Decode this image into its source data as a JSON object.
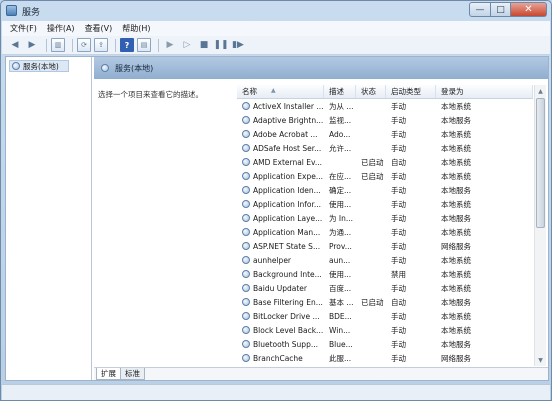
{
  "window": {
    "title": "服务"
  },
  "menu": [
    "文件(F)",
    "操作(A)",
    "查看(V)",
    "帮助(H)"
  ],
  "tree": {
    "root_label": "服务(本地)"
  },
  "panel": {
    "header": "服务(本地)",
    "description_hint": "选择一个项目来查看它的描述。"
  },
  "table": {
    "columns": [
      "名称",
      "描述",
      "状态",
      "启动类型",
      "登录为"
    ],
    "rows": [
      [
        "ActiveX Installer ...",
        "为从 ...",
        "",
        "手动",
        "本地系统"
      ],
      [
        "Adaptive Brightn...",
        "监视...",
        "",
        "手动",
        "本地服务"
      ],
      [
        "Adobe Acrobat ...",
        "Ado...",
        "",
        "手动",
        "本地系统"
      ],
      [
        "ADSafe Host Ser...",
        "允许...",
        "",
        "手动",
        "本地系统"
      ],
      [
        "AMD External Ev...",
        "",
        "已启动",
        "自动",
        "本地系统"
      ],
      [
        "Application Expe...",
        "在应...",
        "已启动",
        "手动",
        "本地系统"
      ],
      [
        "Application Iden...",
        "确定...",
        "",
        "手动",
        "本地服务"
      ],
      [
        "Application Infor...",
        "使用...",
        "",
        "手动",
        "本地系统"
      ],
      [
        "Application Laye...",
        "为 In...",
        "",
        "手动",
        "本地服务"
      ],
      [
        "Application Man...",
        "为通...",
        "",
        "手动",
        "本地系统"
      ],
      [
        "ASP.NET State S...",
        "Prov...",
        "",
        "手动",
        "网络服务"
      ],
      [
        "aunhelper",
        "aun...",
        "",
        "手动",
        "本地系统"
      ],
      [
        "Background Inte...",
        "使用...",
        "",
        "禁用",
        "本地系统"
      ],
      [
        "Baidu Updater",
        "百度...",
        "",
        "手动",
        "本地系统"
      ],
      [
        "Base Filtering En...",
        "基本 ...",
        "已启动",
        "自动",
        "本地服务"
      ],
      [
        "BitLocker Drive ...",
        "BDE...",
        "",
        "手动",
        "本地系统"
      ],
      [
        "Block Level Back...",
        "Win...",
        "",
        "手动",
        "本地系统"
      ],
      [
        "Bluetooth Supp...",
        "Blue...",
        "",
        "手动",
        "本地服务"
      ],
      [
        "BranchCache",
        "此服...",
        "",
        "手动",
        "网络服务"
      ]
    ]
  },
  "tabs": [
    "扩展",
    "标准"
  ]
}
